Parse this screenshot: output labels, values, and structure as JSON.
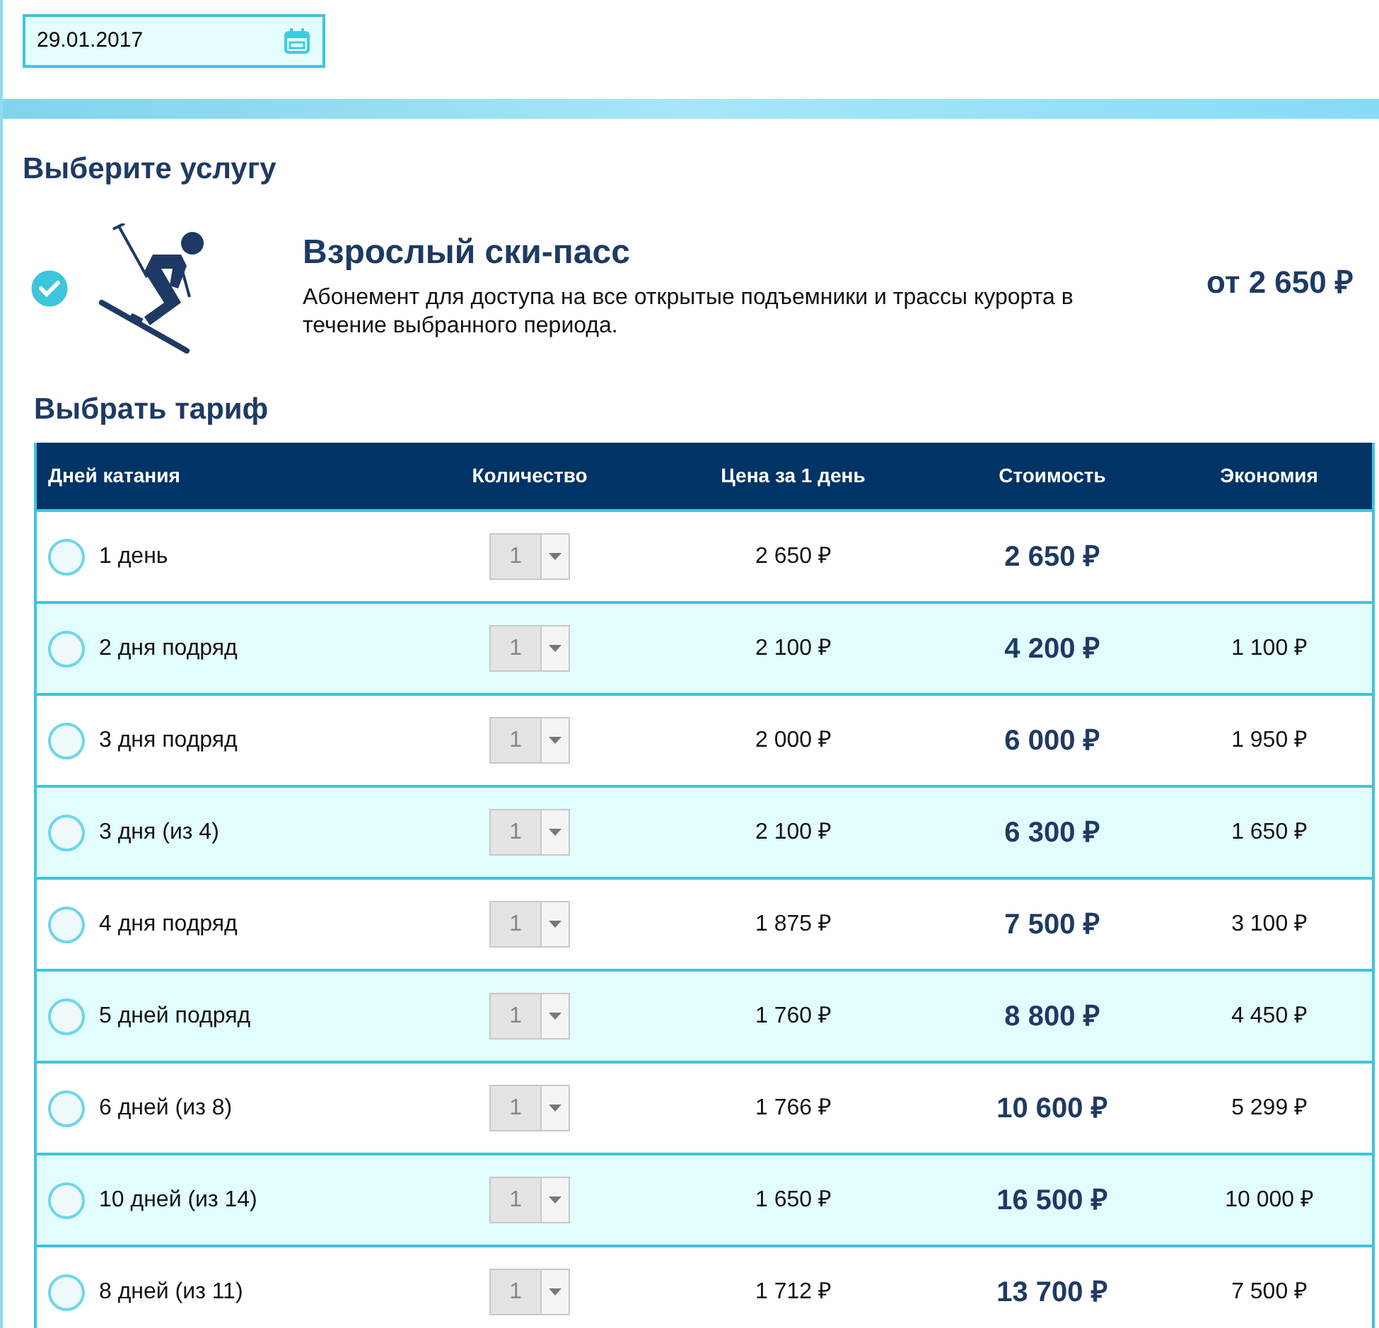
{
  "date_field": {
    "value": "29.01.2017"
  },
  "service_section": {
    "title": "Выберите услугу"
  },
  "service": {
    "selected": true,
    "name": "Взрослый ски-пасс",
    "description": "Абонемент для доступа на все открытые подъемники и трассы курорта в течение выбранного периода.",
    "price": "от 2 650 ₽"
  },
  "tariff_section": {
    "title": "Выбрать тариф"
  },
  "table": {
    "columns": [
      "Дней катания",
      "Количество",
      "Цена за 1 день",
      "Стоимость",
      "Экономия"
    ],
    "rows": [
      {
        "selected": false,
        "days": "1 день",
        "quantity": "1",
        "price_per_day": "2 650 ₽",
        "total": "2 650 ₽"
      },
      {
        "selected": false,
        "days": "2 дня подряд",
        "quantity": "1",
        "price_per_day": "2 100 ₽",
        "total": "4 200 ₽",
        "savings": "1 100 ₽"
      },
      {
        "selected": false,
        "days": "3 дня подряд",
        "quantity": "1",
        "price_per_day": "2 000 ₽",
        "total": "6 000 ₽",
        "savings": "1 950 ₽"
      },
      {
        "selected": false,
        "days": "3 дня (из 4)",
        "quantity": "1",
        "price_per_day": "2 100 ₽",
        "total": "6 300 ₽",
        "savings": "1 650 ₽"
      },
      {
        "selected": false,
        "days": "4 дня подряд",
        "quantity": "1",
        "price_per_day": "1 875 ₽",
        "total": "7 500 ₽",
        "savings": "3 100 ₽"
      },
      {
        "selected": false,
        "days": "5 дней подряд",
        "quantity": "1",
        "price_per_day": "1 760 ₽",
        "total": "8 800 ₽",
        "savings": "4 450 ₽"
      },
      {
        "selected": false,
        "days": "6 дней (из 8)",
        "quantity": "1",
        "price_per_day": "1 766 ₽",
        "total": "10 600 ₽",
        "savings": "5 299 ₽"
      },
      {
        "selected": false,
        "days": "10 дней (из 14)",
        "quantity": "1",
        "price_per_day": "1 650 ₽",
        "total": "16 500 ₽",
        "savings": "10 000 ₽"
      },
      {
        "selected": false,
        "days": "8 дней (из 11)",
        "quantity": "1",
        "price_per_day": "1 712 ₽",
        "total": "13 700 ₽",
        "savings": "7 500 ₽"
      }
    ]
  }
}
